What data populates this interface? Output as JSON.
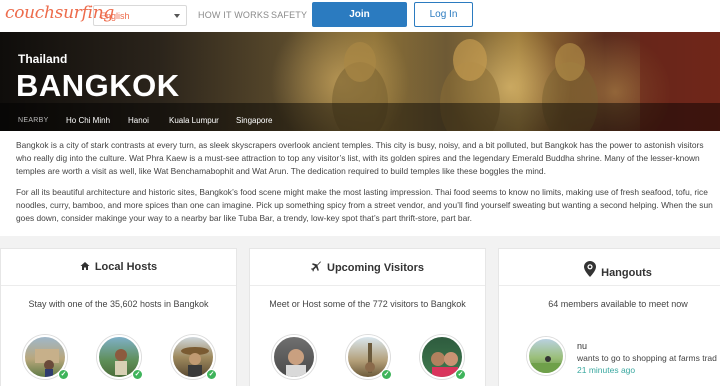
{
  "header": {
    "logo": "couchsurfing",
    "language": "English",
    "nav": [
      "HOW IT WORKS",
      "SAFETY"
    ],
    "join_label": "Join",
    "login_label": "Log In"
  },
  "hero": {
    "country": "Thailand",
    "city": "BANGKOK",
    "nearby_label": "NEARBY",
    "nearby": [
      "Ho Chi Minh",
      "Hanoi",
      "Kuala Lumpur",
      "Singapore"
    ]
  },
  "description": {
    "p1": "Bangkok is a city of stark contrasts at every turn, as sleek skyscrapers overlook ancient temples. This city is busy, noisy, and a bit polluted, but Bangkok has the power to astonish visitors who really dig into the culture. Wat Phra Kaew is a must-see attraction to top any visitor’s list, with its golden spires and the legendary Emerald Buddha shrine. Many of the lesser-known temples are worth a visit as well, like Wat Benchamabophit and Wat Arun. The dedication required to build temples like these boggles the mind.",
    "p2": "For all its beautiful architecture and historic sites, Bangkok’s food scene might make the most lasting impression. Thai food seems to know no limits, making use of fresh seafood, tofu, rice noodles, curry, bamboo, and more spices than one can imagine. Pick up something spicy from a street vendor, and you’ll find yourself sweating but wanting a second helping. When the sun goes down, consider makinge your way to a nearby bar like Tuba Bar, a trendy, low-key spot that’s part thrift-store, part bar."
  },
  "cards": {
    "hosts": {
      "title": "Local Hosts",
      "subtitle": "Stay with one of the 35,602 hosts in Bangkok",
      "icon": "home-icon"
    },
    "visitors": {
      "title": "Upcoming Visitors",
      "subtitle": "Meet or Host some of the 772 visitors to Bangkok",
      "icon": "airplane-icon"
    },
    "hangouts": {
      "title": "Hangouts",
      "subtitle": "64 members available to meet now",
      "icon": "location-pin-icon",
      "member_name": "nu",
      "message": "wants to go to shopping at farms trad",
      "time": "21 minutes ago"
    }
  },
  "colors": {
    "brand": "#ed6b4b",
    "primary": "#2b7bc0",
    "verified": "#3fb45b",
    "time": "#3aa8a0"
  }
}
